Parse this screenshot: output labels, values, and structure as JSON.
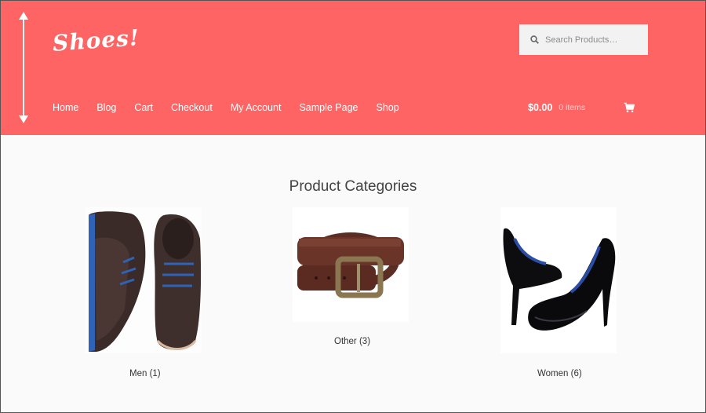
{
  "brand": {
    "logo": "Shoes!"
  },
  "search": {
    "placeholder": "Search Products…"
  },
  "nav": {
    "items": [
      "Home",
      "Blog",
      "Cart",
      "Checkout",
      "My Account",
      "Sample Page",
      "Shop"
    ]
  },
  "cart": {
    "amount": "$0.00",
    "items": "0 items"
  },
  "main": {
    "title": "Product Categories",
    "categories": [
      {
        "name": "Men",
        "count": "(1)"
      },
      {
        "name": "Other",
        "count": "(3)"
      },
      {
        "name": "Women",
        "count": "(6)"
      }
    ]
  },
  "colors": {
    "header": "#ff6464",
    "body": "#fafafa",
    "text": "#333333"
  }
}
